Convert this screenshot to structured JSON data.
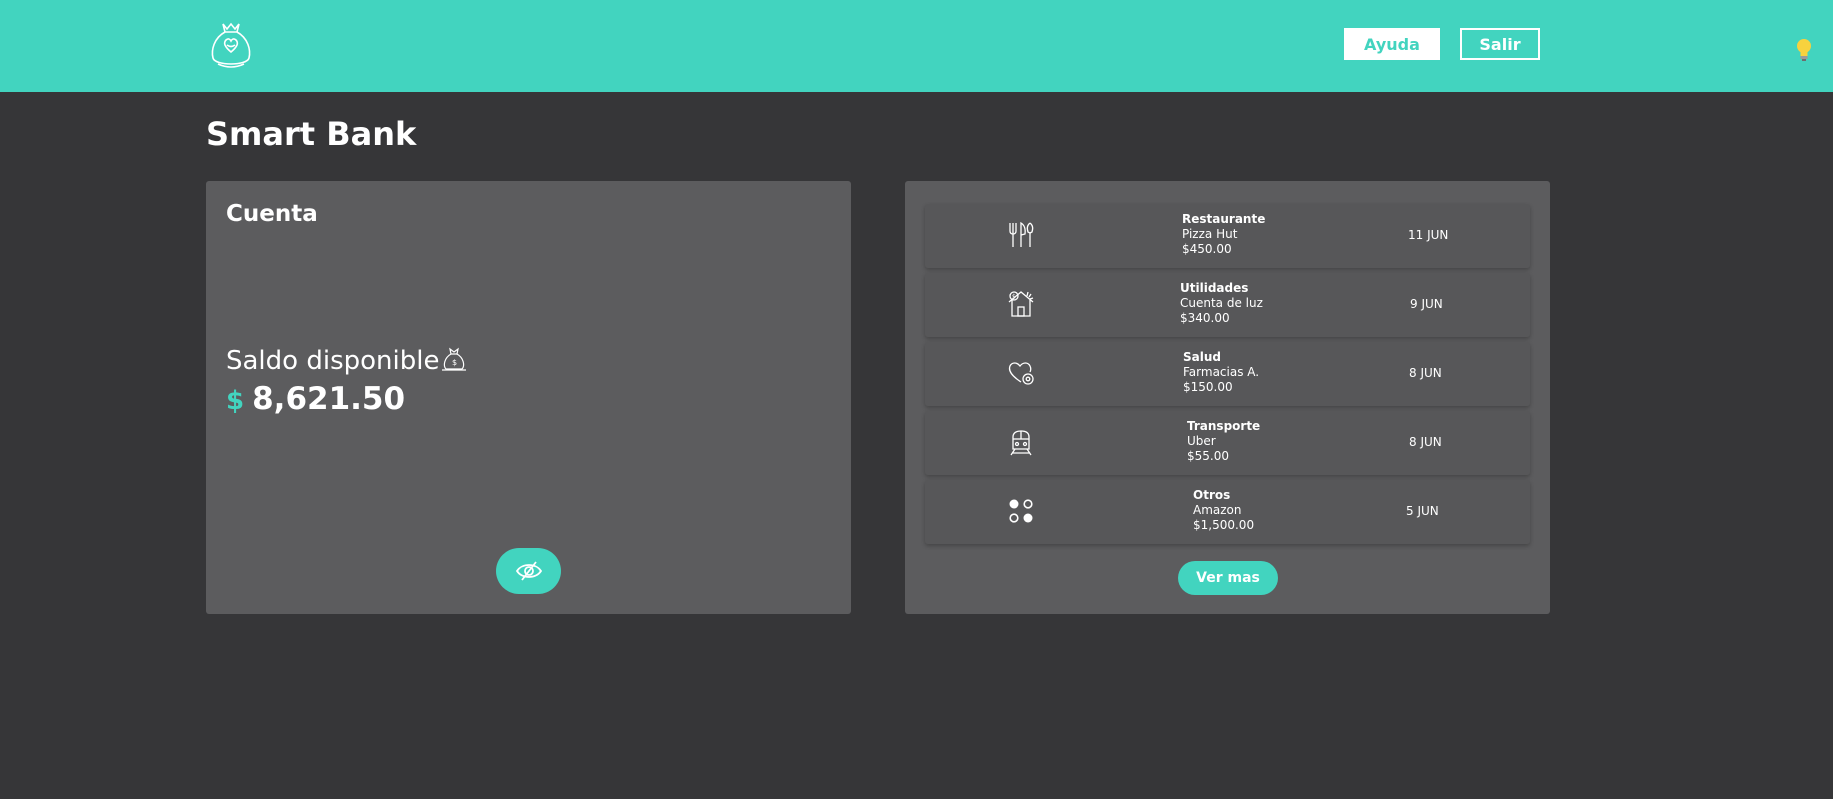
{
  "brand": {
    "logo_icon": "money-bag-heart-icon",
    "accent_color": "#42d4bf",
    "background_color": "#363638",
    "card_color": "#5c5c5e"
  },
  "header": {
    "help_label": "Ayuda",
    "exit_label": "Salir",
    "theme_icon": "lightbulb-icon"
  },
  "page": {
    "title": "Smart Bank"
  },
  "account": {
    "title": "Cuenta",
    "balance_label": "Saldo disponible",
    "balance_icon": "money-bag-icon",
    "currency_symbol": "$",
    "balance": "8,621.50",
    "toggle_icon": "eye-slash-icon"
  },
  "transactions": {
    "items": [
      {
        "icon": "fork-knife-icon",
        "category": "Restaurante",
        "merchant": "Pizza Hut",
        "amount": "$450.00",
        "date": "11 JUN"
      },
      {
        "icon": "house-dollar-icon",
        "category": "Utilidades",
        "merchant": "Cuenta de luz",
        "amount": "$340.00",
        "date": "9 JUN"
      },
      {
        "icon": "heart-health-icon",
        "category": "Salud",
        "merchant": "Farmacias A.",
        "amount": "$150.00",
        "date": "8 JUN"
      },
      {
        "icon": "train-icon",
        "category": "Transporte",
        "merchant": "Uber",
        "amount": "$55.00",
        "date": "8 JUN"
      },
      {
        "icon": "dots-grid-icon",
        "category": "Otros",
        "merchant": "Amazon",
        "amount": "$1,500.00",
        "date": "5 JUN"
      }
    ],
    "more_label": "Ver mas"
  }
}
